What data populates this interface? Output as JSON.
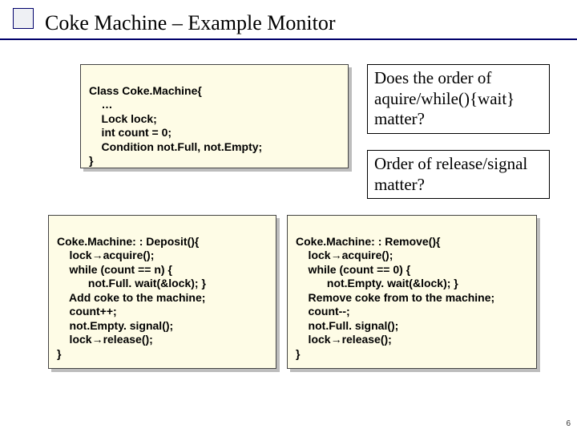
{
  "title": "Coke Machine – Example Monitor",
  "class_box": {
    "lines": [
      "Class Coke.Machine{",
      "    …",
      "    Lock lock;",
      "    int count = 0;",
      "    Condition not.Full, not.Empty;",
      "}"
    ]
  },
  "question1": "Does the order of aquire/while(){wait} matter?",
  "question2": "Order of release/signal matter?",
  "deposit_box": {
    "lines": [
      "Coke.Machine: : Deposit(){",
      "    lock→acquire();",
      "    while (count == n) {",
      "          not.Full. wait(&lock); }",
      "    Add coke to the machine;",
      "    count++;",
      "    not.Empty. signal();",
      "    lock→release();",
      "}"
    ]
  },
  "remove_box": {
    "lines": [
      "Coke.Machine: : Remove(){",
      "    lock→acquire();",
      "    while (count == 0) {",
      "          not.Empty. wait(&lock); }",
      "    Remove coke from to the machine;",
      "    count--;",
      "    not.Full. signal();",
      "    lock→release();",
      "}"
    ]
  },
  "slide_number": "6"
}
